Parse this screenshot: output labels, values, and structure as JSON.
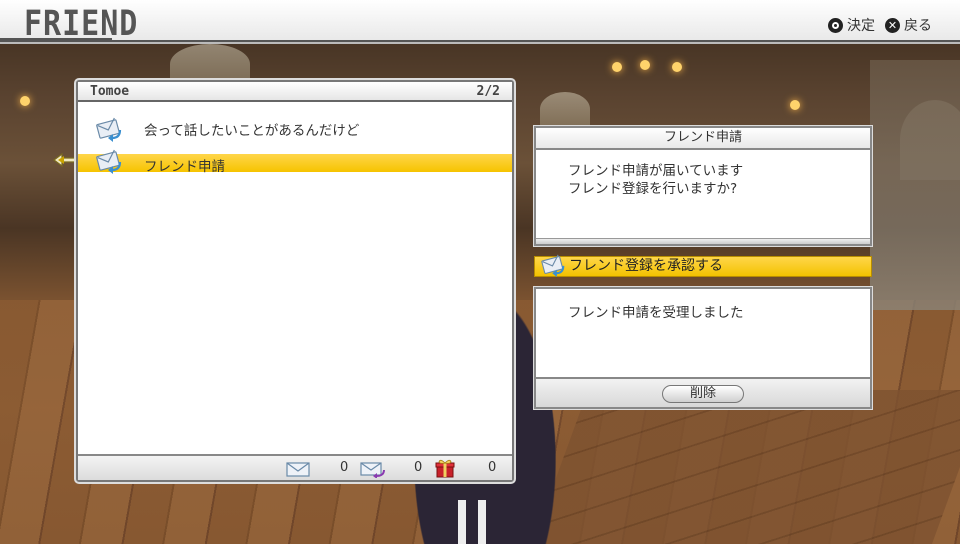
{
  "header": {
    "title": "FRIEND",
    "confirm_label": "決定",
    "back_label": "戻る"
  },
  "message_list": {
    "friend_name": "Tomoe",
    "page": "2/2",
    "items": [
      {
        "text": "会って話したいことがあるんだけど",
        "selected": false,
        "icon": "mail-reply-icon"
      },
      {
        "text": "フレンド申請",
        "selected": true,
        "icon": "mail-reply-icon"
      }
    ],
    "footer": {
      "mail_count": "0",
      "reply_count": "0",
      "gift_count": "0"
    }
  },
  "detail": {
    "title": "フレンド申請",
    "line1": "フレンド申請が届いています",
    "line2": "フレンド登録を行いますか?",
    "approve_label": "フレンド登録を承認する",
    "result_text": "フレンド申請を受理しました",
    "delete_label": "削除"
  },
  "colors": {
    "highlight": "#f6c400",
    "panel": "#ffffff",
    "border": "#777777"
  }
}
